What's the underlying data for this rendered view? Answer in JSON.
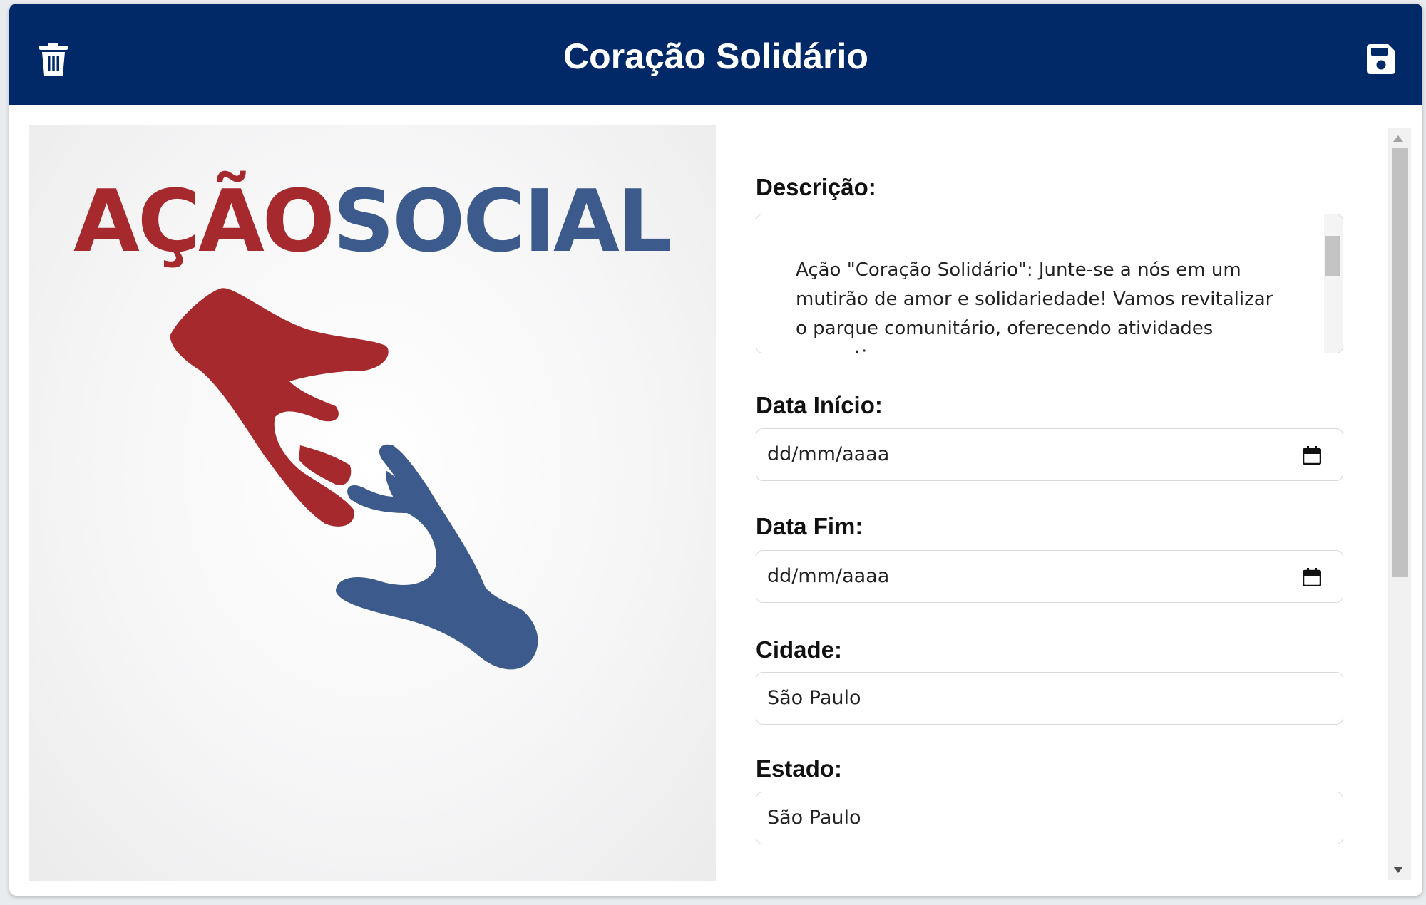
{
  "header": {
    "title": "Coração Solidário",
    "left_icon": "trash-icon",
    "right_icon": "save-icon",
    "background": "#012967"
  },
  "logo": {
    "word_red": "AÇÃO",
    "word_blue": "SOCIAL",
    "red_color": "#a6292e",
    "blue_color": "#3c5a8c"
  },
  "form": {
    "descricao": {
      "label": "Descrição:",
      "value": "Ação \"Coração Solidário\": Junte-se a nós em um mutirão de amor e solidariedade! Vamos revitalizar o parque comunitário, oferecendo atividades recreativas"
    },
    "data_inicio": {
      "label": "Data Início:",
      "placeholder": "dd/mm/aaaa",
      "icon": "calendar-icon"
    },
    "data_fim": {
      "label": "Data Fim:",
      "placeholder": "dd/mm/aaaa",
      "icon": "calendar-icon"
    },
    "cidade": {
      "label": "Cidade:",
      "value": "São Paulo"
    },
    "estado": {
      "label": "Estado:",
      "value": "São Paulo"
    }
  }
}
